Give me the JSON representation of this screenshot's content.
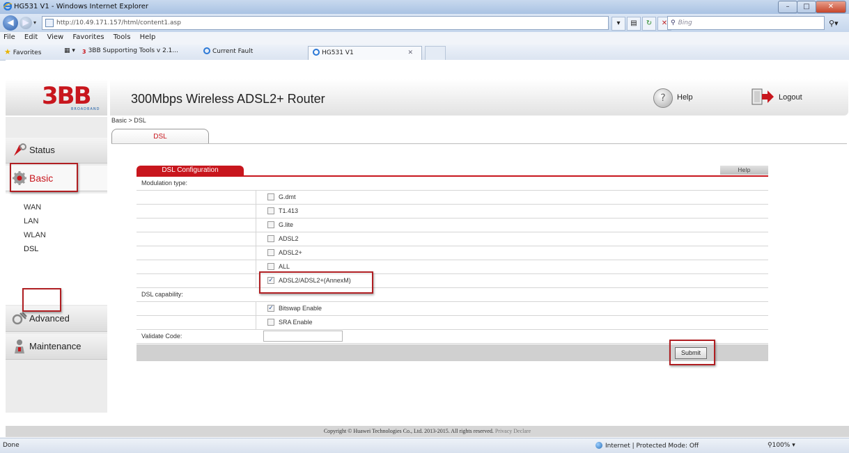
{
  "browser": {
    "window_title": "HG531 V1 - Windows Internet Explorer",
    "url": "http://10.49.171.157/html/content1.asp",
    "search_placeholder": "Bing",
    "menu": [
      "File",
      "Edit",
      "View",
      "Favorites",
      "Tools",
      "Help"
    ],
    "favorites_label": "Favorites",
    "favorites_links": [
      "3BB Supporting Tools v 2.1...",
      "Current Fault"
    ],
    "active_tab": "HG531 V1",
    "status_text": "Done",
    "security_zone": "Internet | Protected Mode: Off",
    "zoom": "100%"
  },
  "router": {
    "logo_text": "3BB",
    "logo_subtext": "BROADBAND",
    "title": "300Mbps Wireless ADSL2+ Router",
    "help_label": "Help",
    "logout_label": "Logout",
    "breadcrumb": "Basic > DSL",
    "tab_label": "DSL",
    "nav": {
      "status": "Status",
      "basic": "Basic",
      "advanced": "Advanced",
      "maintenance": "Maintenance",
      "basic_sub": [
        "WAN",
        "LAN",
        "WLAN",
        "DSL"
      ]
    },
    "panel": {
      "title": "DSL Configuration",
      "help_button": "Help",
      "modulation_label": "Modulation type:",
      "modulation_options": [
        {
          "label": "G.dmt",
          "checked": false
        },
        {
          "label": "T1.413",
          "checked": false
        },
        {
          "label": "G.lite",
          "checked": false
        },
        {
          "label": "ADSL2",
          "checked": false
        },
        {
          "label": "ADSL2+",
          "checked": false
        },
        {
          "label": "ALL",
          "checked": false
        },
        {
          "label": "ADSL2/ADSL2+(AnnexM)",
          "checked": true
        }
      ],
      "capability_label": "DSL capability:",
      "capability_options": [
        {
          "label": "Bitswap Enable",
          "checked": true
        },
        {
          "label": "SRA Enable",
          "checked": false
        }
      ],
      "validate_label": "Validate Code:",
      "validate_value": "",
      "submit_label": "Submit"
    },
    "copyright": "Copyright © Huawei Technologies Co., Ltd. 2013-2015. All rights reserved.",
    "privacy_link": "Privacy Declare"
  },
  "colors": {
    "brand_red": "#c8161d",
    "highlight_box": "#b01e22",
    "logo_blue": "#1c5fa8"
  }
}
